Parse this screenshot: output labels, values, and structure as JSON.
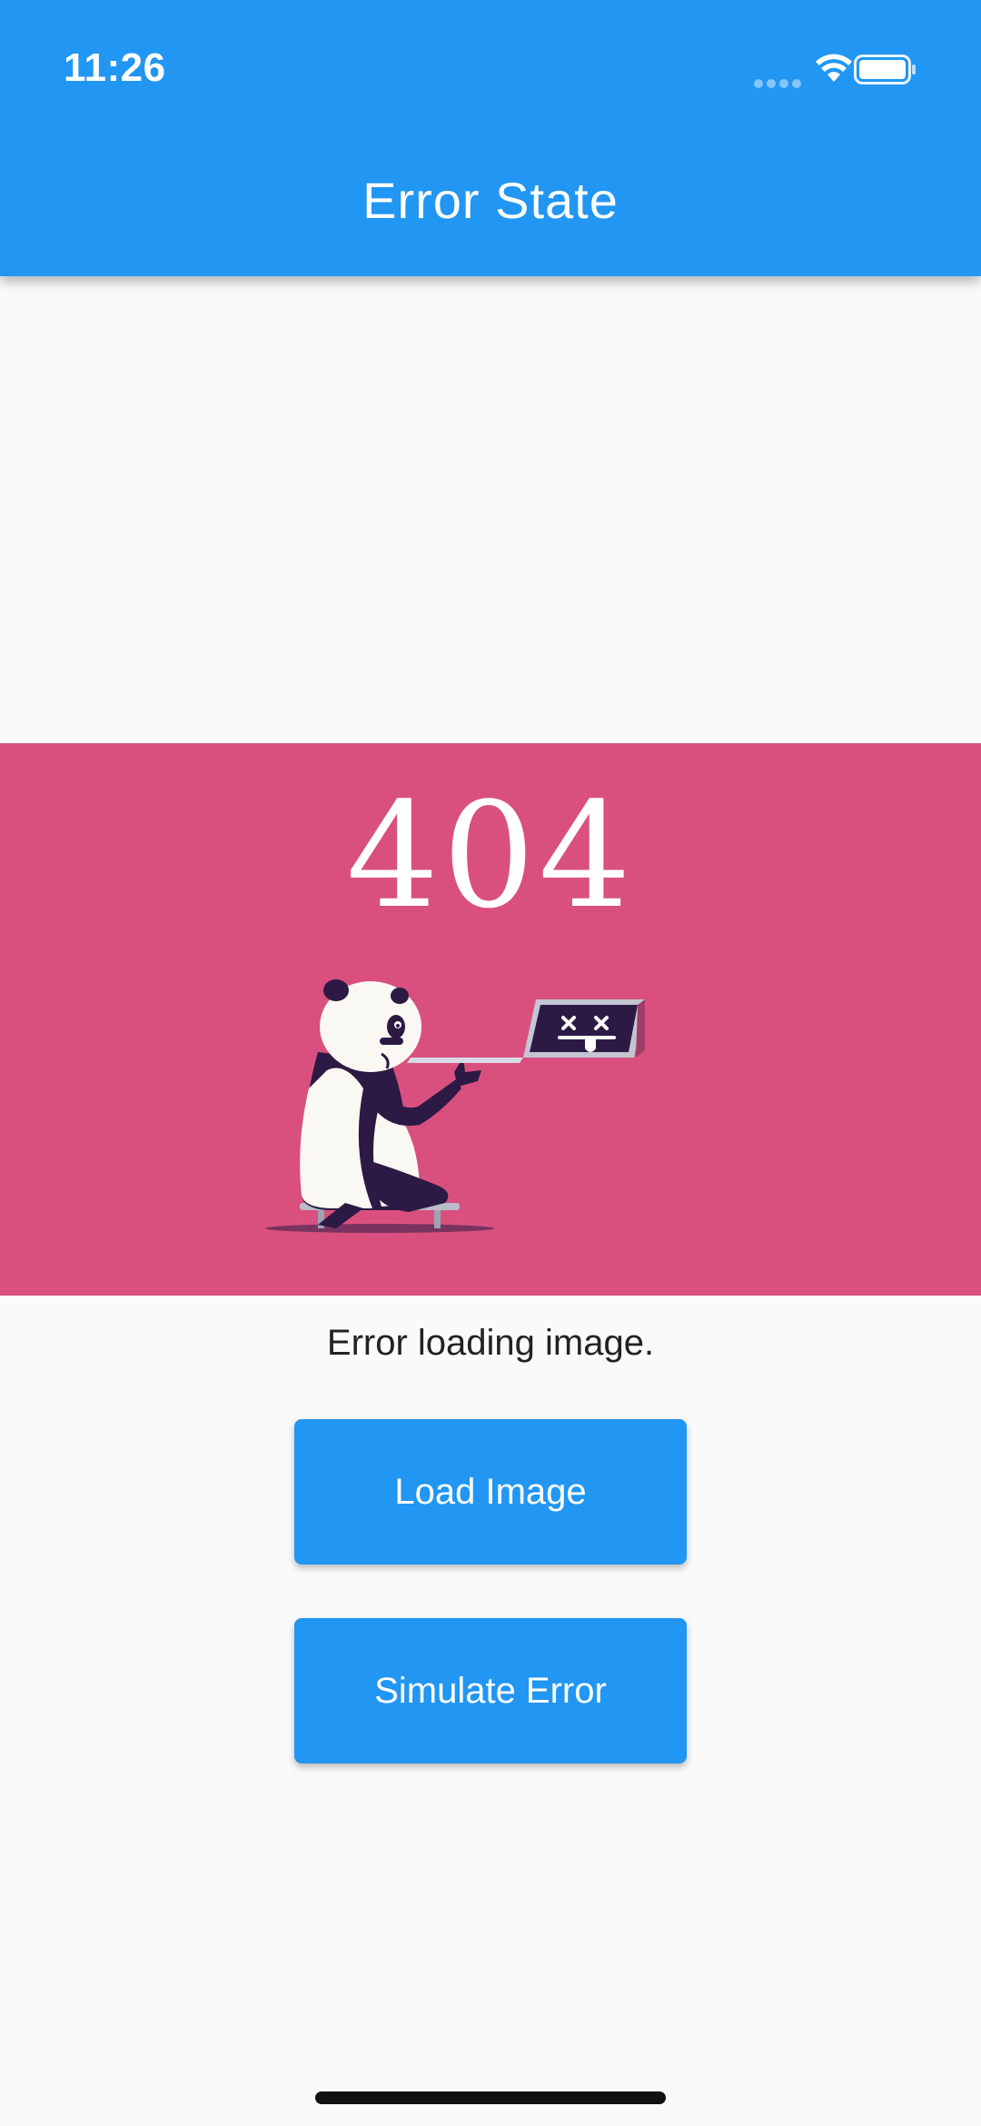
{
  "status_bar": {
    "time": "11:26",
    "icons": [
      "signal-icon",
      "wifi-icon",
      "battery-icon"
    ]
  },
  "app_bar": {
    "title": "Error State",
    "color": "#2196f3"
  },
  "hero": {
    "error_code": "404",
    "background": "#d9507f",
    "illustration": "panda-with-broken-laptop"
  },
  "message": {
    "text": "Error loading image."
  },
  "buttons": {
    "load_label": "Load Image",
    "simulate_label": "Simulate Error"
  }
}
